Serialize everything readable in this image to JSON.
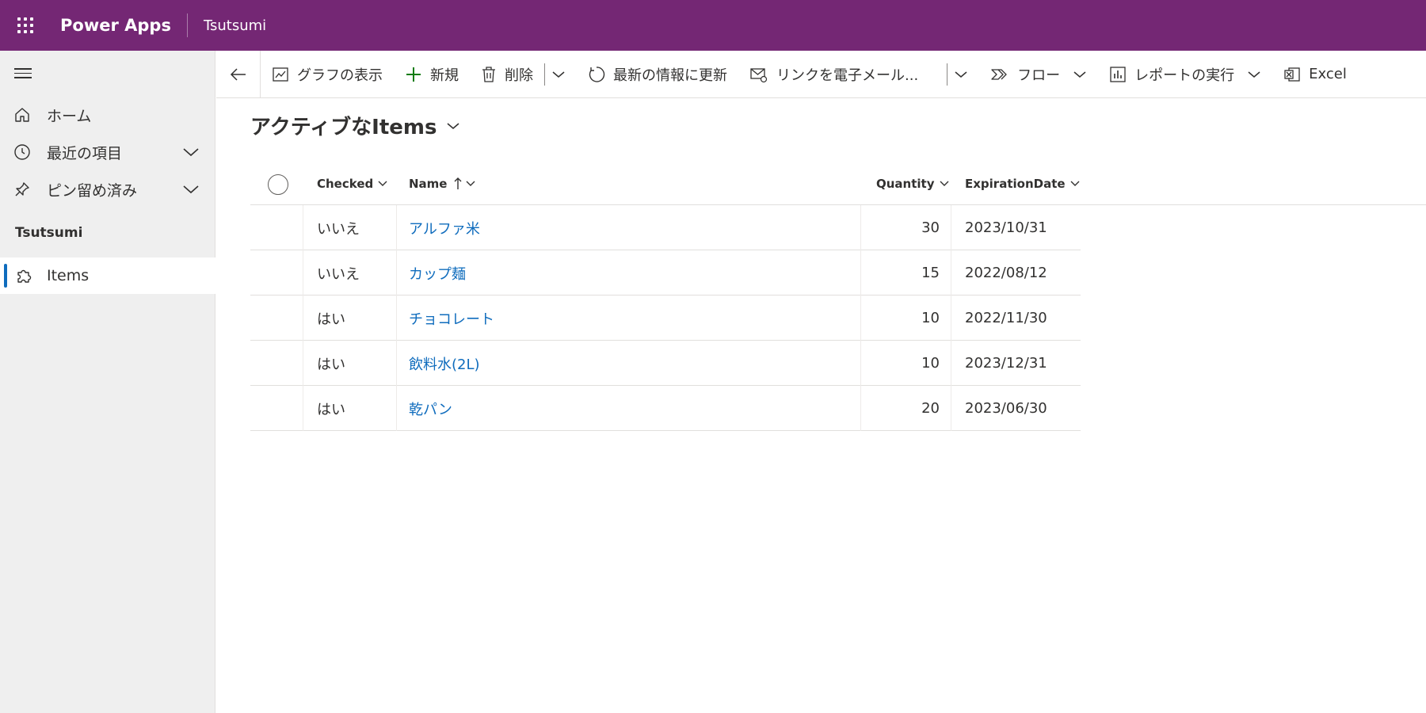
{
  "topbar": {
    "app_name": "Power Apps",
    "environment": "Tsutsumi"
  },
  "sidebar": {
    "items": [
      {
        "label": "ホーム",
        "icon": "home-icon"
      },
      {
        "label": "最近の項目",
        "icon": "clock-icon"
      },
      {
        "label": "ピン留め済み",
        "icon": "pin-icon"
      }
    ],
    "group_title": "Tsutsumi",
    "entity_item": {
      "label": "Items",
      "icon": "puzzle-icon",
      "selected": true
    }
  },
  "commandbar": {
    "show_chart": "グラフの表示",
    "new": "新規",
    "delete": "削除",
    "refresh": "最新の情報に更新",
    "email_link": "リンクを電子メール...",
    "flow": "フロー",
    "run_report": "レポートの実行",
    "excel": "Excel"
  },
  "view": {
    "title": "アクティブなItems"
  },
  "grid": {
    "columns": {
      "checked": "Checked",
      "name": "Name",
      "quantity": "Quantity",
      "expiration": "ExpirationDate"
    },
    "rows": [
      {
        "checked": "いいえ",
        "name": "アルファ米",
        "quantity": "30",
        "expiration": "2023/10/31"
      },
      {
        "checked": "いいえ",
        "name": "カップ麺",
        "quantity": "15",
        "expiration": "2022/08/12"
      },
      {
        "checked": "はい",
        "name": "チョコレート",
        "quantity": "10",
        "expiration": "2022/11/30"
      },
      {
        "checked": "はい",
        "name": "飲料水(2L)",
        "quantity": "10",
        "expiration": "2023/12/31"
      },
      {
        "checked": "はい",
        "name": "乾パン",
        "quantity": "20",
        "expiration": "2023/06/30"
      }
    ]
  },
  "colors": {
    "header_bg": "#742774",
    "accent": "#0f6cbd",
    "sidebar_bg": "#efefef"
  }
}
